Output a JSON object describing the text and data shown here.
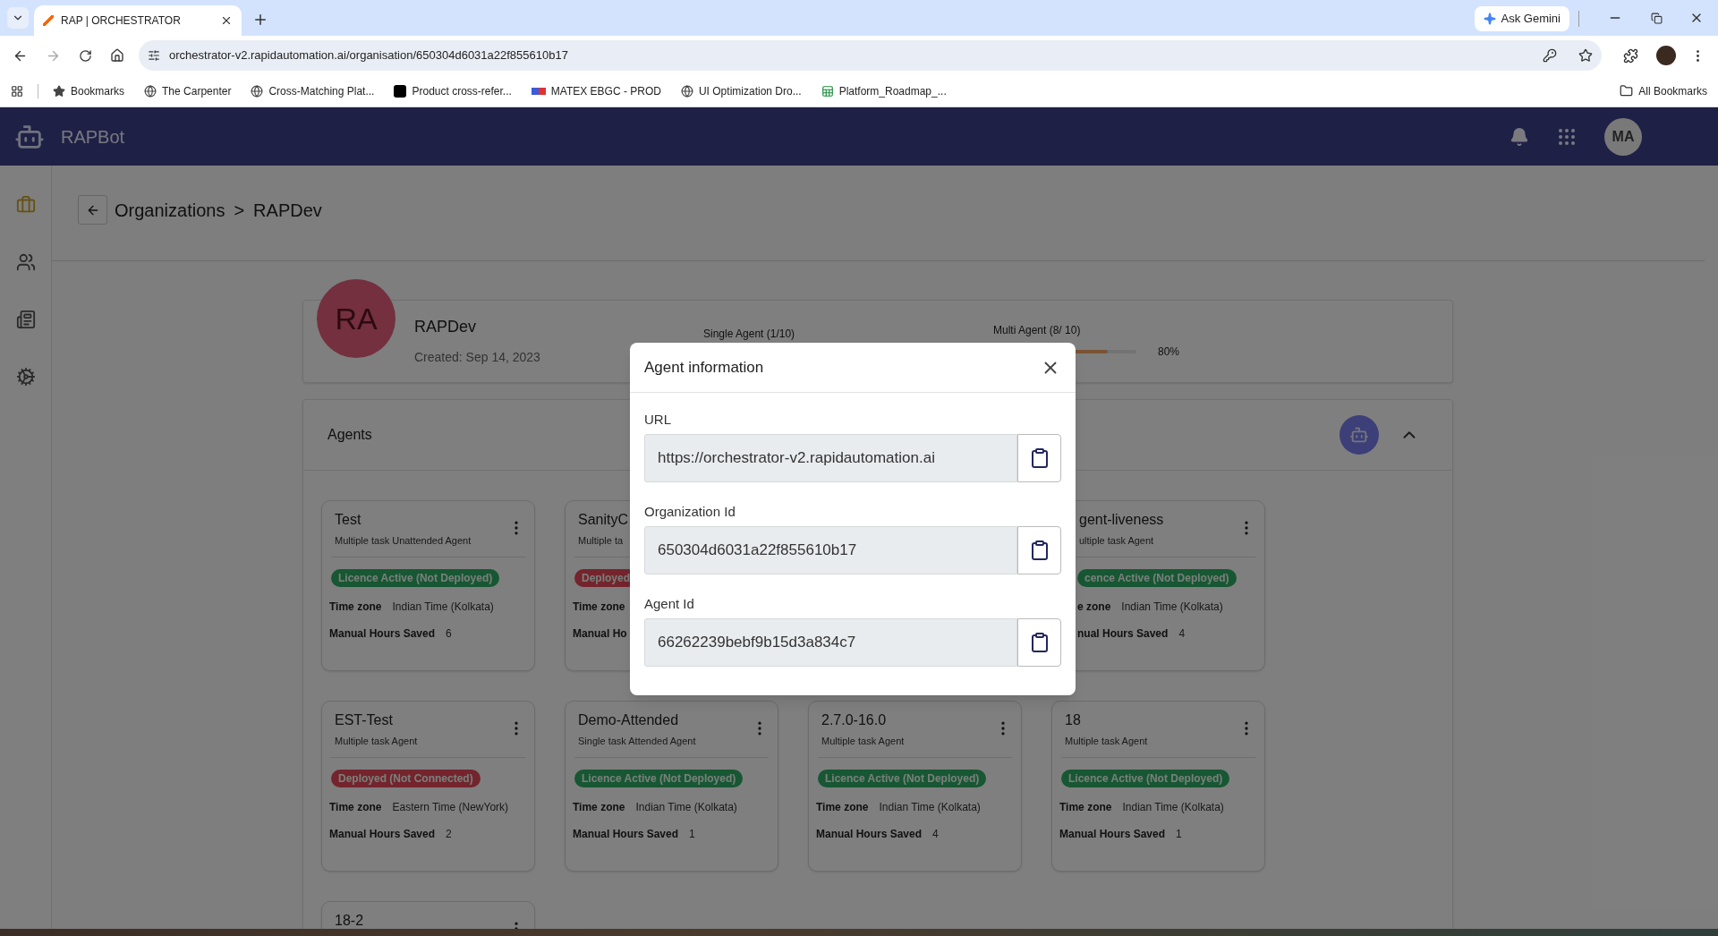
{
  "browser": {
    "tab_title": "RAP | ORCHESTRATOR",
    "assistant_button": "Ask Gemini",
    "url": "orchestrator-v2.rapidautomation.ai/organisation/650304d6031a22f855610b17",
    "bookmarks": [
      {
        "label": "Bookmarks",
        "kind": "star"
      },
      {
        "label": "The Carpenter",
        "kind": "site"
      },
      {
        "label": "Cross-Matching Plat...",
        "kind": "site"
      },
      {
        "label": "Product cross-refer...",
        "kind": "dark"
      },
      {
        "label": "MATEX EBGC - PROD",
        "kind": "brand"
      },
      {
        "label": "UI Optimization Dro...",
        "kind": "site"
      },
      {
        "label": "Platform_Roadmap_...",
        "kind": "sheet"
      }
    ],
    "all_bookmarks": "All Bookmarks"
  },
  "app": {
    "name": "RAPBot",
    "user_initials": "MA",
    "nav": [
      {
        "kind": "briefcase",
        "selected": true
      },
      {
        "kind": "users",
        "selected": false
      },
      {
        "kind": "book",
        "selected": false
      },
      {
        "kind": "settings",
        "selected": false
      }
    ]
  },
  "breadcrumb": {
    "items": [
      "Organizations",
      "RAPDev"
    ],
    "separator": ">"
  },
  "organization": {
    "initials": "RA",
    "name": "RAPDev",
    "created": "Created: Sep 14, 2023",
    "single_agent": {
      "label": "Single Agent (1/10)"
    },
    "multi_agent": {
      "label": "Multi Agent (8/ 10)",
      "level": 0.8,
      "reading": "80%"
    }
  },
  "agents_panel": {
    "title": "Agents",
    "expanded": true
  },
  "agents": [
    {
      "name": "Test",
      "type": "Multiple task Unattended Agent",
      "status": {
        "label": "Licence Active (Not Deployed)",
        "kind": "active"
      },
      "timezone_label": "Time zone",
      "timezone": "Indian Time (Kolkata)",
      "hours_label": "Manual Hours Saved",
      "hours": "6"
    },
    {
      "name": "SanityC",
      "type": "Multiple ta",
      "status": {
        "label": "Deployed",
        "kind": "deployed"
      },
      "timezone_label": "Time zone",
      "hours_label": "Manual Ho"
    },
    {
      "name": "gent-liveness",
      "type": "ultiple task Agent",
      "status": {
        "label": "cence Active (Not Deployed)",
        "kind": "active"
      },
      "timezone_label": "e zone",
      "timezone": "Indian Time (Kolkata)",
      "hours_label": "nual Hours Saved",
      "hours": "4"
    },
    {
      "name": "EST-Test",
      "type": "Multiple task Agent",
      "status": {
        "label": "Deployed (Not Connected)",
        "kind": "deployed"
      },
      "timezone_label": "Time zone",
      "timezone": "Eastern Time (NewYork)",
      "hours_label": "Manual Hours Saved",
      "hours": "2"
    },
    {
      "name": "Demo-Attended",
      "type": "Single task Attended Agent",
      "status": {
        "label": "Licence Active (Not Deployed)",
        "kind": "active"
      },
      "timezone_label": "Time zone",
      "timezone": "Indian Time (Kolkata)",
      "hours_label": "Manual Hours Saved",
      "hours": "1"
    },
    {
      "name": "2.7.0-16.0",
      "type": "Multiple task Agent",
      "status": {
        "label": "Licence Active (Not Deployed)",
        "kind": "active"
      },
      "timezone_label": "Time zone",
      "timezone": "Indian Time (Kolkata)",
      "hours_label": "Manual Hours Saved",
      "hours": "4"
    },
    {
      "name": "18",
      "type": "Multiple task Agent",
      "status": {
        "label": "Licence Active (Not Deployed)",
        "kind": "active"
      },
      "timezone_label": "Time zone",
      "timezone": "Indian Time (Kolkata)",
      "hours_label": "Manual Hours Saved",
      "hours": "1"
    },
    {
      "name": "18-2"
    }
  ],
  "dialog": {
    "title": "Agent information",
    "fields": [
      {
        "label": "URL",
        "value": "https://orchestrator-v2.rapidautomation.ai"
      },
      {
        "label": "Organization Id",
        "value": "650304d6031a22f855610b17"
      },
      {
        "label": "Agent Id",
        "value": "66262239bebf9b15d3a834c7"
      }
    ]
  }
}
